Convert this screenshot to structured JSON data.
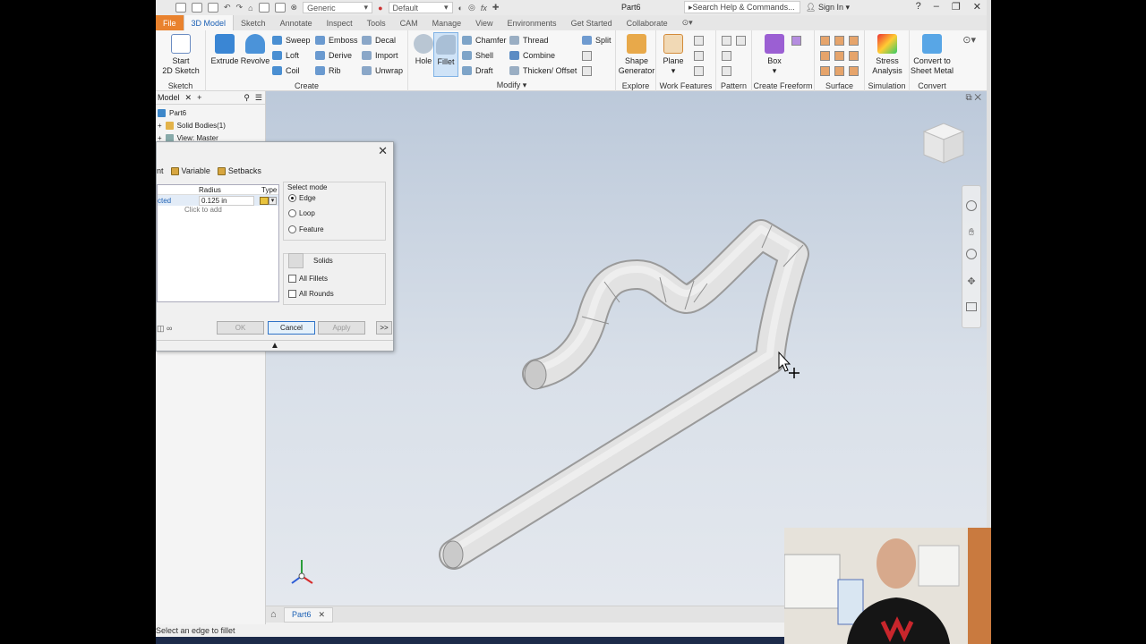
{
  "titlebar": {
    "material": "Generic",
    "appearance": "Default",
    "doc_title": "Part6",
    "search_placeholder": "Search Help & Commands...",
    "sign_in": "Sign In"
  },
  "tabs": [
    "File",
    "3D Model",
    "Sketch",
    "Annotate",
    "Inspect",
    "Tools",
    "CAM",
    "Manage",
    "View",
    "Environments",
    "Get Started",
    "Collaborate"
  ],
  "ribbon": {
    "sketch": {
      "start_label_1": "Start",
      "start_label_2": "2D Sketch",
      "group": "Sketch"
    },
    "create": {
      "extrude": "Extrude",
      "revolve": "Revolve",
      "sweep": "Sweep",
      "loft": "Loft",
      "coil": "Coil",
      "emboss": "Emboss",
      "derive": "Derive",
      "rib": "Rib",
      "decal": "Decal",
      "import": "Import",
      "unwrap": "Unwrap",
      "group": "Create"
    },
    "modify": {
      "hole": "Hole",
      "fillet": "Fillet",
      "chamfer": "Chamfer",
      "shell": "Shell",
      "draft": "Draft",
      "thread": "Thread",
      "combine": "Combine",
      "thicken": "Thicken/ Offset",
      "split": "Split",
      "group": "Modify"
    },
    "explore": {
      "shape_1": "Shape",
      "shape_2": "Generator",
      "group": "Explore"
    },
    "work": {
      "plane": "Plane",
      "group": "Work Features"
    },
    "pattern": {
      "group": "Pattern"
    },
    "freeform": {
      "box": "Box",
      "group": "Create Freeform"
    },
    "surface": {
      "group": "Surface"
    },
    "simulation": {
      "stress_1": "Stress",
      "stress_2": "Analysis",
      "group": "Simulation"
    },
    "convert": {
      "label_1": "Convert to",
      "label_2": "Sheet Metal",
      "group": "Convert"
    }
  },
  "browser": {
    "tab": "Model",
    "items": [
      "Part6",
      "Solid Bodies(1)",
      "View: Master"
    ]
  },
  "dialog": {
    "tabs": [
      "nt",
      "Variable",
      "Setbacks"
    ],
    "table_headers": [
      "Radius",
      "Type"
    ],
    "row": {
      "edges": "cted",
      "radius": "0.125 in"
    },
    "click_to_add": "Click to add",
    "select_mode_title": "Select mode",
    "modes": [
      "Edge",
      "Loop",
      "Feature"
    ],
    "selected_mode": "Edge",
    "solids": "Solids",
    "all_fillets": "All Fillets",
    "all_rounds": "All Rounds",
    "ok": "OK",
    "cancel": "Cancel",
    "apply": "Apply",
    "more": ">>"
  },
  "doc_tab": "Part6",
  "status": "Select an edge to fillet",
  "colors": {
    "accent": "#1a5fb4",
    "file_tab": "#e9822e",
    "part": "#dcdcdc"
  }
}
